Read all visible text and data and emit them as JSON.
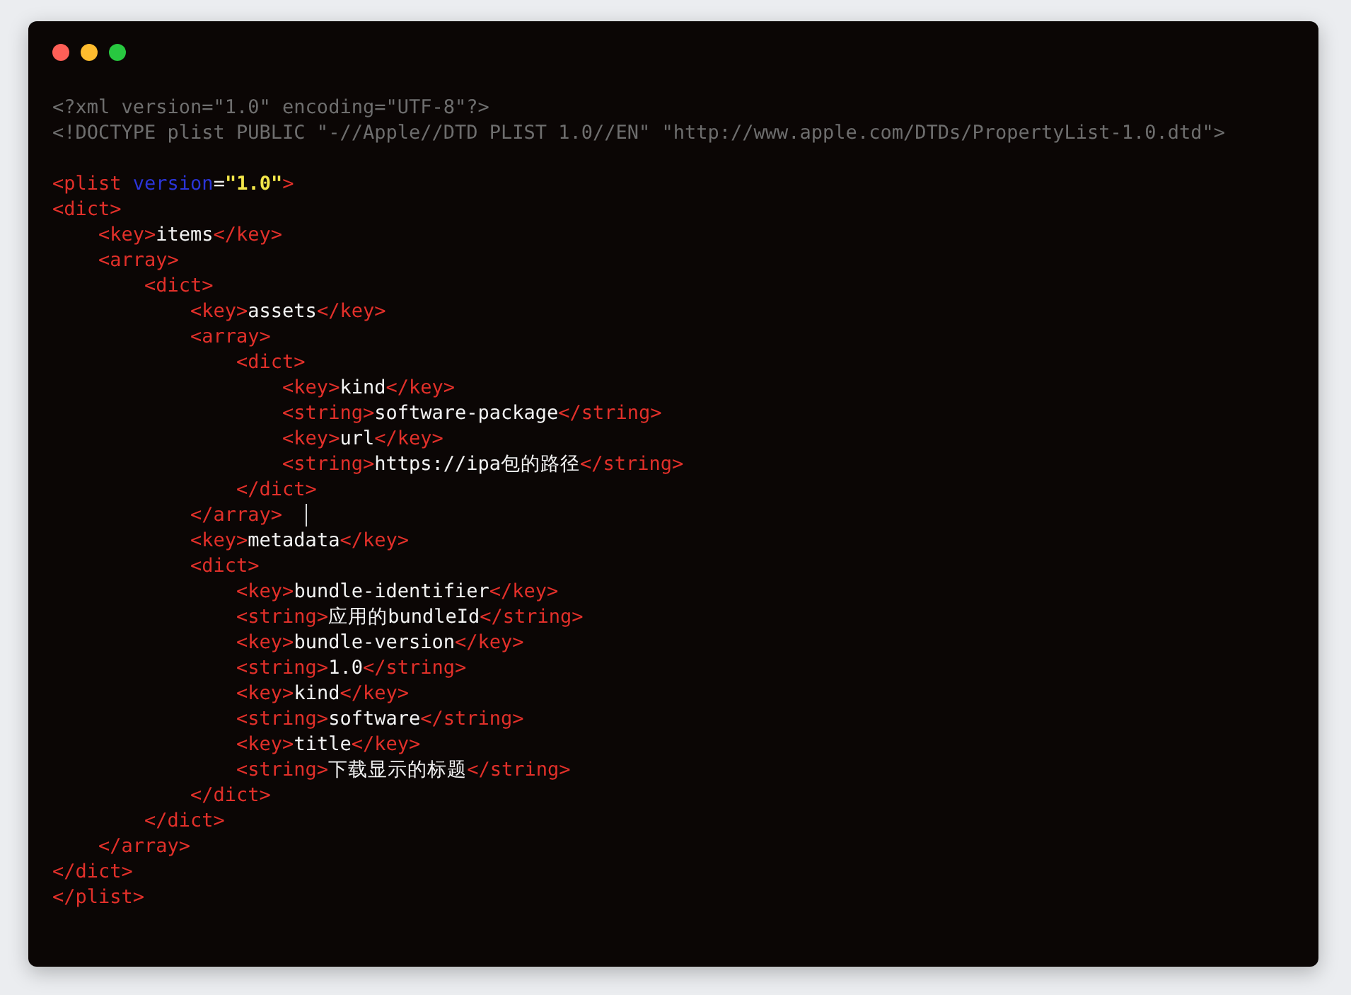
{
  "window": {
    "controls": [
      {
        "kind": "close"
      },
      {
        "kind": "minimize"
      },
      {
        "kind": "zoom"
      }
    ]
  },
  "sections": [
    {
      "lines": [
        {
          "cursor": false,
          "tokens": [
            {
              "kind": "decl",
              "text": "<?xml version=\"1.0\" encoding=\"UTF-8\"?>"
            }
          ]
        },
        {
          "cursor": false,
          "tokens": [
            {
              "kind": "decl",
              "text": "<!DOCTYPE plist PUBLIC \"-//Apple//DTD PLIST 1.0//EN\" \"http://www.apple.com/DTDs/PropertyList-1.0.dtd\">"
            }
          ]
        }
      ]
    },
    {
      "lines": [
        {
          "cursor": false,
          "tokens": [
            {
              "kind": "tag",
              "text": "<plist"
            },
            {
              "kind": "attr",
              "text": " version"
            },
            {
              "kind": "text",
              "text": "="
            },
            {
              "kind": "value",
              "text": "\"1.0\""
            },
            {
              "kind": "tag",
              "text": ">"
            }
          ]
        },
        {
          "cursor": false,
          "tokens": [
            {
              "kind": "tag",
              "text": "<dict>"
            }
          ]
        },
        {
          "cursor": false,
          "tokens": [
            {
              "kind": "tag",
              "text": "    <key>"
            },
            {
              "kind": "text",
              "text": "items"
            },
            {
              "kind": "tag",
              "text": "</key>"
            }
          ]
        },
        {
          "cursor": false,
          "tokens": [
            {
              "kind": "tag",
              "text": "    <array>"
            }
          ]
        },
        {
          "cursor": false,
          "tokens": [
            {
              "kind": "tag",
              "text": "        <dict>"
            }
          ]
        },
        {
          "cursor": false,
          "tokens": [
            {
              "kind": "tag",
              "text": "            <key>"
            },
            {
              "kind": "text",
              "text": "assets"
            },
            {
              "kind": "tag",
              "text": "</key>"
            }
          ]
        },
        {
          "cursor": false,
          "tokens": [
            {
              "kind": "tag",
              "text": "            <array>"
            }
          ]
        },
        {
          "cursor": false,
          "tokens": [
            {
              "kind": "tag",
              "text": "                <dict>"
            }
          ]
        },
        {
          "cursor": false,
          "tokens": [
            {
              "kind": "tag",
              "text": "                    <key>"
            },
            {
              "kind": "text",
              "text": "kind"
            },
            {
              "kind": "tag",
              "text": "</key>"
            }
          ]
        },
        {
          "cursor": false,
          "tokens": [
            {
              "kind": "tag",
              "text": "                    <string>"
            },
            {
              "kind": "text",
              "text": "software-package"
            },
            {
              "kind": "tag",
              "text": "</string>"
            }
          ]
        },
        {
          "cursor": false,
          "tokens": [
            {
              "kind": "tag",
              "text": "                    <key>"
            },
            {
              "kind": "text",
              "text": "url"
            },
            {
              "kind": "tag",
              "text": "</key>"
            }
          ]
        },
        {
          "cursor": false,
          "tokens": [
            {
              "kind": "tag",
              "text": "                    <string>"
            },
            {
              "kind": "text",
              "text": "https://ipa包的路径"
            },
            {
              "kind": "tag",
              "text": "</string>"
            }
          ]
        },
        {
          "cursor": false,
          "tokens": [
            {
              "kind": "tag",
              "text": "                </dict>"
            }
          ]
        },
        {
          "cursor": true,
          "tokens": [
            {
              "kind": "tag",
              "text": "            </array>"
            }
          ]
        },
        {
          "cursor": false,
          "tokens": [
            {
              "kind": "tag",
              "text": "            <key>"
            },
            {
              "kind": "text",
              "text": "metadata"
            },
            {
              "kind": "tag",
              "text": "</key>"
            }
          ]
        },
        {
          "cursor": false,
          "tokens": [
            {
              "kind": "tag",
              "text": "            <dict>"
            }
          ]
        },
        {
          "cursor": false,
          "tokens": [
            {
              "kind": "tag",
              "text": "                <key>"
            },
            {
              "kind": "text",
              "text": "bundle-identifier"
            },
            {
              "kind": "tag",
              "text": "</key>"
            }
          ]
        },
        {
          "cursor": false,
          "tokens": [
            {
              "kind": "tag",
              "text": "                <string>"
            },
            {
              "kind": "text",
              "text": "应用的bundleId"
            },
            {
              "kind": "tag",
              "text": "</string>"
            }
          ]
        },
        {
          "cursor": false,
          "tokens": [
            {
              "kind": "tag",
              "text": "                <key>"
            },
            {
              "kind": "text",
              "text": "bundle-version"
            },
            {
              "kind": "tag",
              "text": "</key>"
            }
          ]
        },
        {
          "cursor": false,
          "tokens": [
            {
              "kind": "tag",
              "text": "                <string>"
            },
            {
              "kind": "text",
              "text": "1.0"
            },
            {
              "kind": "tag",
              "text": "</string>"
            }
          ]
        },
        {
          "cursor": false,
          "tokens": [
            {
              "kind": "tag",
              "text": "                <key>"
            },
            {
              "kind": "text",
              "text": "kind"
            },
            {
              "kind": "tag",
              "text": "</key>"
            }
          ]
        },
        {
          "cursor": false,
          "tokens": [
            {
              "kind": "tag",
              "text": "                <string>"
            },
            {
              "kind": "text",
              "text": "software"
            },
            {
              "kind": "tag",
              "text": "</string>"
            }
          ]
        },
        {
          "cursor": false,
          "tokens": [
            {
              "kind": "tag",
              "text": "                <key>"
            },
            {
              "kind": "text",
              "text": "title"
            },
            {
              "kind": "tag",
              "text": "</key>"
            }
          ]
        },
        {
          "cursor": false,
          "tokens": [
            {
              "kind": "tag",
              "text": "                <string>"
            },
            {
              "kind": "text",
              "text": "下载显示的标题"
            },
            {
              "kind": "tag",
              "text": "</string>"
            }
          ]
        },
        {
          "cursor": false,
          "tokens": [
            {
              "kind": "tag",
              "text": "            </dict>"
            }
          ]
        },
        {
          "cursor": false,
          "tokens": [
            {
              "kind": "tag",
              "text": "        </dict>"
            }
          ]
        },
        {
          "cursor": false,
          "tokens": [
            {
              "kind": "tag",
              "text": "    </array>"
            }
          ]
        },
        {
          "cursor": false,
          "tokens": [
            {
              "kind": "tag",
              "text": "</dict>"
            }
          ]
        },
        {
          "cursor": false,
          "tokens": [
            {
              "kind": "tag",
              "text": "</plist>"
            }
          ]
        }
      ]
    }
  ]
}
